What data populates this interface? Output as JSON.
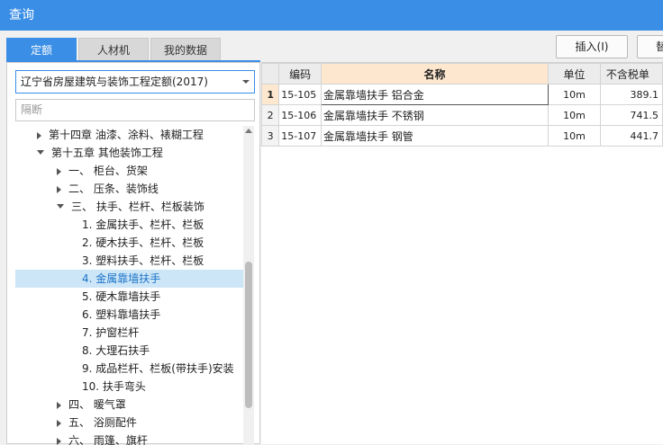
{
  "window": {
    "title": "查询"
  },
  "tabs": [
    {
      "label": "定额",
      "active": true
    },
    {
      "label": "人材机",
      "active": false
    },
    {
      "label": "我的数据",
      "active": false
    }
  ],
  "toolbar": {
    "insert_label": "插入(I)",
    "replace_label": "替"
  },
  "library_select": {
    "value": "辽宁省房屋建筑与装饰工程定额(2017)"
  },
  "search": {
    "placeholder": "隔断"
  },
  "tree": [
    {
      "label": "第十四章 油漆、涂料、裱糊工程",
      "toggle": "collapsed",
      "level": 1,
      "selected": false
    },
    {
      "label": "第十五章 其他装饰工程",
      "toggle": "expanded",
      "level": 1,
      "selected": false
    },
    {
      "label": "一、 柜台、货架",
      "toggle": "collapsed",
      "level": 2,
      "selected": false
    },
    {
      "label": "二、 压条、装饰线",
      "toggle": "collapsed",
      "level": 2,
      "selected": false
    },
    {
      "label": "三、 扶手、栏杆、栏板装饰",
      "toggle": "expanded",
      "level": 2,
      "selected": false
    },
    {
      "label": "1. 金属扶手、栏杆、栏板",
      "toggle": "none",
      "level": 3,
      "selected": false
    },
    {
      "label": "2. 硬木扶手、栏杆、栏板",
      "toggle": "none",
      "level": 3,
      "selected": false
    },
    {
      "label": "3. 塑料扶手、栏杆、栏板",
      "toggle": "none",
      "level": 3,
      "selected": false
    },
    {
      "label": "4. 金属靠墙扶手",
      "toggle": "none",
      "level": 3,
      "selected": true
    },
    {
      "label": "5. 硬木靠墙扶手",
      "toggle": "none",
      "level": 3,
      "selected": false
    },
    {
      "label": "6. 塑料靠墙扶手",
      "toggle": "none",
      "level": 3,
      "selected": false
    },
    {
      "label": "7. 护窗栏杆",
      "toggle": "none",
      "level": 3,
      "selected": false
    },
    {
      "label": "8. 大理石扶手",
      "toggle": "none",
      "level": 3,
      "selected": false
    },
    {
      "label": "9. 成品栏杆、栏板(带扶手)安装",
      "toggle": "none",
      "level": 3,
      "selected": false
    },
    {
      "label": "10. 扶手弯头",
      "toggle": "none",
      "level": 3,
      "selected": false
    },
    {
      "label": "四、 暖气罩",
      "toggle": "collapsed",
      "level": 2,
      "selected": false
    },
    {
      "label": "五、 浴厕配件",
      "toggle": "collapsed",
      "level": 2,
      "selected": false
    },
    {
      "label": "六、 雨篷、旗杆",
      "toggle": "collapsed",
      "level": 2,
      "selected": false
    }
  ],
  "table": {
    "columns": [
      "",
      "编码",
      "名称",
      "单位",
      "不含税单"
    ],
    "rows": [
      {
        "num": "1",
        "code": "15-105",
        "name": "金属靠墙扶手 铝合金",
        "unit": "10m",
        "price": "389.1",
        "current": true
      },
      {
        "num": "2",
        "code": "15-106",
        "name": "金属靠墙扶手 不锈钢",
        "unit": "10m",
        "price": "741.5",
        "current": false
      },
      {
        "num": "3",
        "code": "15-107",
        "name": "金属靠墙扶手 钢管",
        "unit": "10m",
        "price": "441.7",
        "current": false
      }
    ]
  },
  "colors": {
    "accent": "#3a8ee6",
    "selected_row_bg": "#cde6f7",
    "header_highlight": "#fde7cf"
  }
}
